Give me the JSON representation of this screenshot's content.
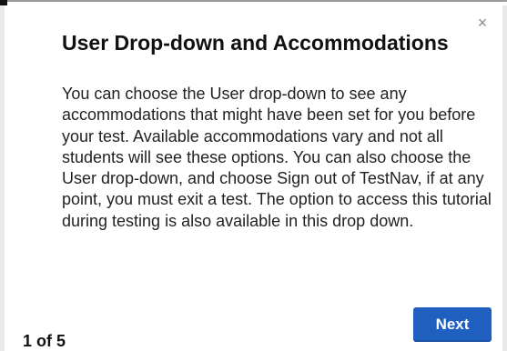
{
  "dialog": {
    "title": "User Drop-down and Accommodations",
    "body": "You can choose the User drop-down to see any accommodations that might have been set for you before your test. Available accommodations vary and not all students will see these options. You can also choose the User drop-down, and choose Sign out of TestNav, if at any point, you must exit a test. The option to access this tutorial during testing is also available in this drop down.",
    "close_glyph": "×",
    "page_counter": "1 of 5",
    "next_label": "Next"
  },
  "colors": {
    "accent": "#1f5fbf",
    "text": "#222222",
    "close": "#8a8a8a"
  },
  "icons": {
    "close": "close-icon"
  }
}
